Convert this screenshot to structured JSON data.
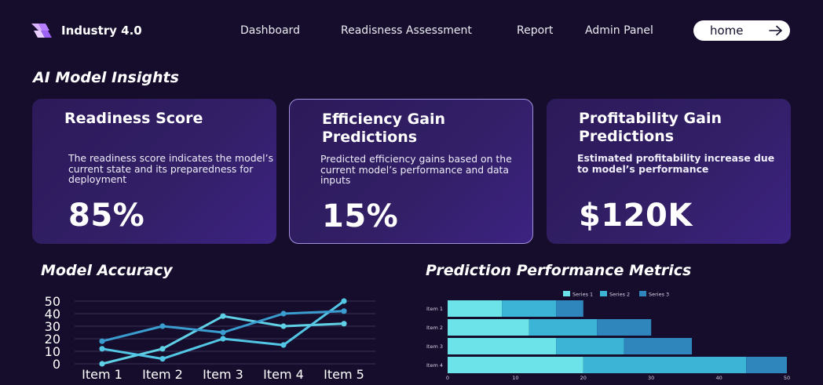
{
  "header": {
    "brand": "Industry 4.0",
    "nav": [
      "Dashboard",
      "Readisness Assessment",
      "Report",
      "Admin Panel"
    ],
    "home_label": "home"
  },
  "icons": {
    "logo": "brand-logo-icon",
    "home_arrow": "arrow-right-icon"
  },
  "section_title": "AI Model Insights",
  "cards": [
    {
      "title": "Readiness Score",
      "desc": "The readiness score indicates the model’s current state and its preparedness for deployment",
      "value": "85%"
    },
    {
      "title": "Efficiency Gain Predictions",
      "desc": "Predicted efficiency gains based on the current model’s performance and data inputs",
      "value": "15%"
    },
    {
      "title": "Profitability Gain Predictions",
      "desc": "Estimated profitability increase due to model’s performance",
      "value": "$120K"
    }
  ],
  "colors": {
    "background": "#150d2b",
    "card_start": "#2c1a5a",
    "card_end": "#3c2382",
    "card_highlight_border": "#a18fe0"
  },
  "chart_titles": [
    "Model Accuracy",
    "Prediction Performance Metrics"
  ],
  "chart_data": [
    {
      "type": "line",
      "categories": [
        "Item 1",
        "Item 2",
        "Item 3",
        "Item 4",
        "Item 5"
      ],
      "ylim": [
        0,
        50
      ],
      "yticks": [
        0,
        10,
        20,
        30,
        40,
        50
      ],
      "grid": true,
      "series": [
        {
          "values": [
            0,
            12,
            38,
            30,
            32
          ],
          "color": "#5fd0e6"
        },
        {
          "values": [
            12,
            4,
            20,
            15,
            50
          ],
          "color": "#52c6e4"
        },
        {
          "values": [
            18,
            30,
            25,
            40,
            42
          ],
          "color": "#3a9ccf"
        }
      ]
    },
    {
      "type": "bar",
      "orientation": "horizontal",
      "stacked": true,
      "categories": [
        "Item 1",
        "Item 2",
        "Item 3",
        "Item 4"
      ],
      "xlim": [
        0,
        50
      ],
      "xticks": [
        0,
        10,
        20,
        30,
        40,
        50
      ],
      "legend_position": "top",
      "series": [
        {
          "name": "Series 1",
          "values": [
            8,
            12,
            16,
            20
          ],
          "color": "#6ce3e8"
        },
        {
          "name": "Series 2",
          "values": [
            8,
            10,
            10,
            24
          ],
          "color": "#3cb4d6"
        },
        {
          "name": "Series 3",
          "values": [
            4,
            8,
            10,
            6
          ],
          "color": "#2e86bd"
        }
      ]
    }
  ]
}
